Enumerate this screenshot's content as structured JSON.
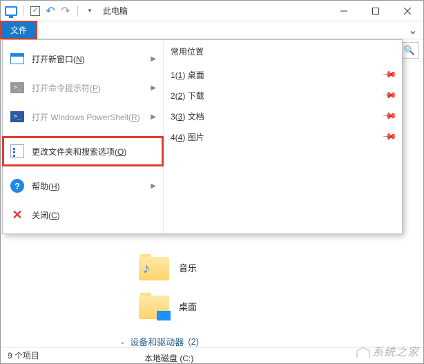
{
  "window": {
    "title": "此电脑",
    "qat": {
      "undo_tip": "撤消",
      "redo_tip": "恢复"
    }
  },
  "ribbon": {
    "file_tab": "文件",
    "expand_tip": "展开功能区"
  },
  "search": {
    "placeholder": "搜"
  },
  "file_menu": {
    "items": [
      {
        "label": "打开新窗口(",
        "accel": "N",
        "tail": ")",
        "has_sub": true,
        "disabled": false,
        "icon": "window"
      },
      {
        "label": "打开命令提示符(",
        "accel": "P",
        "tail": ")",
        "has_sub": true,
        "disabled": true,
        "icon": "cmd"
      },
      {
        "label": "打开 Windows PowerShell(",
        "accel": "R",
        "tail": ")",
        "has_sub": true,
        "disabled": true,
        "icon": "ps"
      },
      {
        "label": "更改文件夹和搜索选项(",
        "accel": "O",
        "tail": ")",
        "has_sub": false,
        "disabled": false,
        "icon": "options",
        "highlight": true
      },
      {
        "label": "帮助(",
        "accel": "H",
        "tail": ")",
        "has_sub": true,
        "disabled": false,
        "icon": "help"
      },
      {
        "label": "关闭(",
        "accel": "C",
        "tail": ")",
        "has_sub": false,
        "disabled": false,
        "icon": "close"
      }
    ],
    "frequent_header": "常用位置",
    "frequent": [
      {
        "idx": "1(",
        "accel": "1",
        "tail": ")  桌面"
      },
      {
        "idx": "2(",
        "accel": "2",
        "tail": ")  下载"
      },
      {
        "idx": "3(",
        "accel": "3",
        "tail": ")  文档"
      },
      {
        "idx": "4(",
        "accel": "4",
        "tail": ")  图片"
      }
    ]
  },
  "content": {
    "folders": [
      {
        "label": "音乐",
        "overlay": "note"
      },
      {
        "label": "桌面",
        "overlay": "square"
      }
    ],
    "devices_header": "设备和驱动器",
    "devices_count": "(2)",
    "drive": "本地磁盘 (C:)"
  },
  "statusbar": {
    "count": "9 个项目"
  },
  "watermark": "系统之家"
}
